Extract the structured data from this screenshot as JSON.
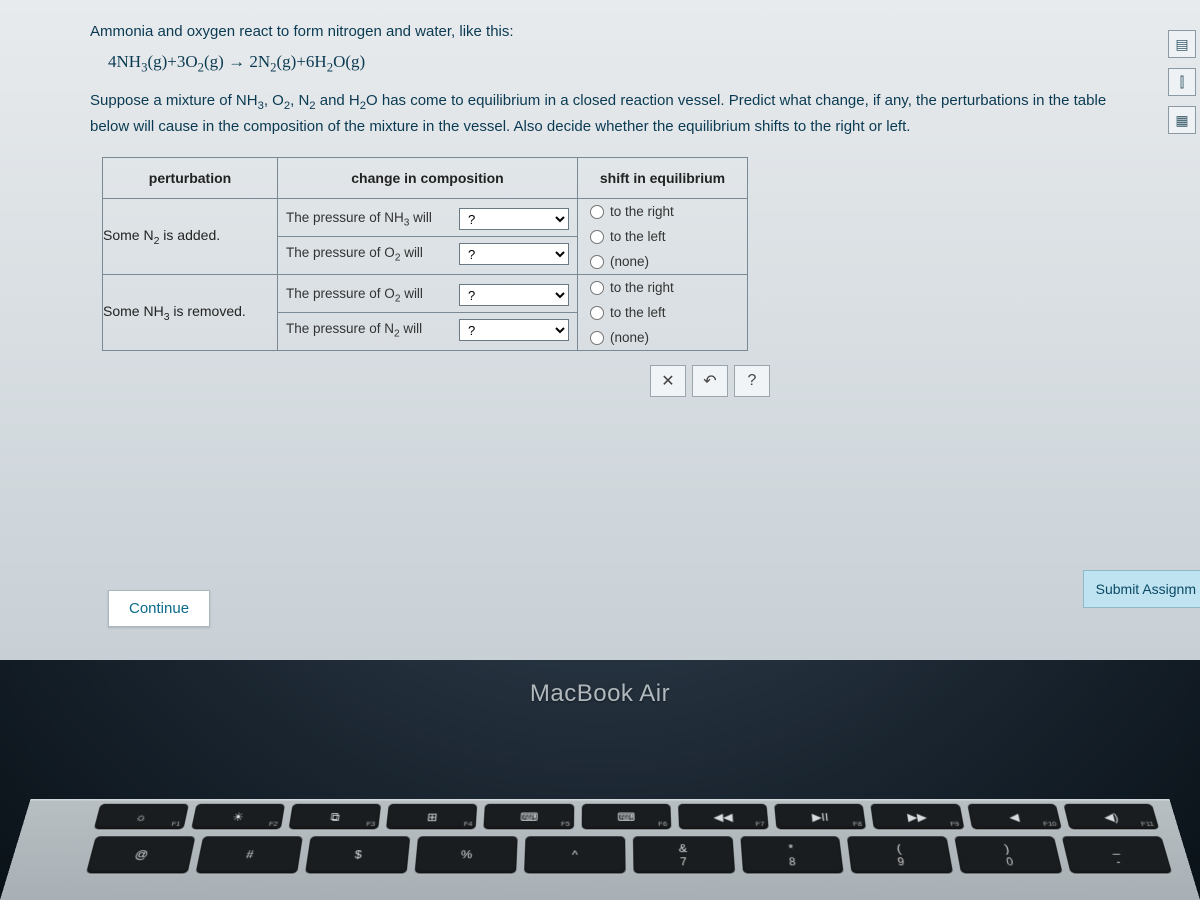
{
  "problem": {
    "intro": "Ammonia and oxygen react to form nitrogen and water, like this:",
    "equation_lhs_1": "4NH",
    "equation_lhs_1_sub": "3",
    "equation_lhs_1_state": "(g)",
    "plus1": "+",
    "equation_lhs_2": "3O",
    "equation_lhs_2_sub": "2",
    "equation_lhs_2_state": "(g)",
    "arrow": " → ",
    "equation_rhs_1": "2N",
    "equation_rhs_1_sub": "2",
    "equation_rhs_1_state": "(g)",
    "plus2": "+",
    "equation_rhs_2": "6H",
    "equation_rhs_2_sub": "2",
    "equation_rhs_2_o": "O",
    "equation_rhs_2_state": "(g)",
    "instr_a": "Suppose a mixture of NH",
    "instr_a_sub": "3",
    "instr_b": ", O",
    "instr_b_sub": "2",
    "instr_c": ", N",
    "instr_c_sub": "2",
    "instr_d": " and H",
    "instr_d_sub": "2",
    "instr_e": "O has come to equilibrium in a closed reaction vessel. Predict what change, if any, the perturbations in the table below will cause in the composition of the mixture in the vessel. Also decide whether the equilibrium shifts to the right or left."
  },
  "table": {
    "headers": {
      "perturbation": "perturbation",
      "change": "change in composition",
      "shift": "shift in equilibrium"
    },
    "rows": [
      {
        "perturbation_a": "Some N",
        "perturbation_a_sub": "2",
        "perturbation_b": " is added.",
        "change1_a": "The pressure of NH",
        "change1_a_sub": "3",
        "change1_b": " will",
        "change2_a": "The pressure of O",
        "change2_a_sub": "2",
        "change2_b": " will"
      },
      {
        "perturbation_a": "Some NH",
        "perturbation_a_sub": "3",
        "perturbation_b": " is removed.",
        "change1_a": "The pressure of O",
        "change1_a_sub": "2",
        "change1_b": " will",
        "change2_a": "The pressure of N",
        "change2_a_sub": "2",
        "change2_b": " will"
      }
    ],
    "select_placeholder": "?",
    "shift_options": {
      "right": "to the right",
      "left": "to the left",
      "none": "(none)"
    }
  },
  "action_bar": {
    "clear": "✕",
    "reset": "↶",
    "help": "?"
  },
  "buttons": {
    "continue": "Continue",
    "submit": "Submit Assignm"
  },
  "side": {
    "calculator": "▤",
    "ruler": "⫿",
    "periodic": "▦"
  },
  "hardware": {
    "brand": "MacBook Air",
    "fn_row": [
      {
        "icon": "☼",
        "label": "F1"
      },
      {
        "icon": "☀",
        "label": "F2"
      },
      {
        "icon": "⧉",
        "label": "F3"
      },
      {
        "icon": "⊞",
        "label": "F4"
      },
      {
        "icon": "⌨",
        "label": "F5"
      },
      {
        "icon": "⌨",
        "label": "F6"
      },
      {
        "icon": "◀◀",
        "label": "F7"
      },
      {
        "icon": "▶II",
        "label": "F8"
      },
      {
        "icon": "▶▶",
        "label": "F9"
      },
      {
        "icon": "◀",
        "label": "F10"
      },
      {
        "icon": "◀)",
        "label": "F11"
      }
    ],
    "num_row": [
      {
        "top": "@",
        "bot": ""
      },
      {
        "top": "#",
        "bot": ""
      },
      {
        "top": "$",
        "bot": ""
      },
      {
        "top": "%",
        "bot": ""
      },
      {
        "top": "^",
        "bot": ""
      },
      {
        "top": "&",
        "bot": "7"
      },
      {
        "top": "*",
        "bot": "8"
      },
      {
        "top": "(",
        "bot": "9"
      },
      {
        "top": ")",
        "bot": "0"
      },
      {
        "top": "_",
        "bot": "-"
      }
    ]
  }
}
